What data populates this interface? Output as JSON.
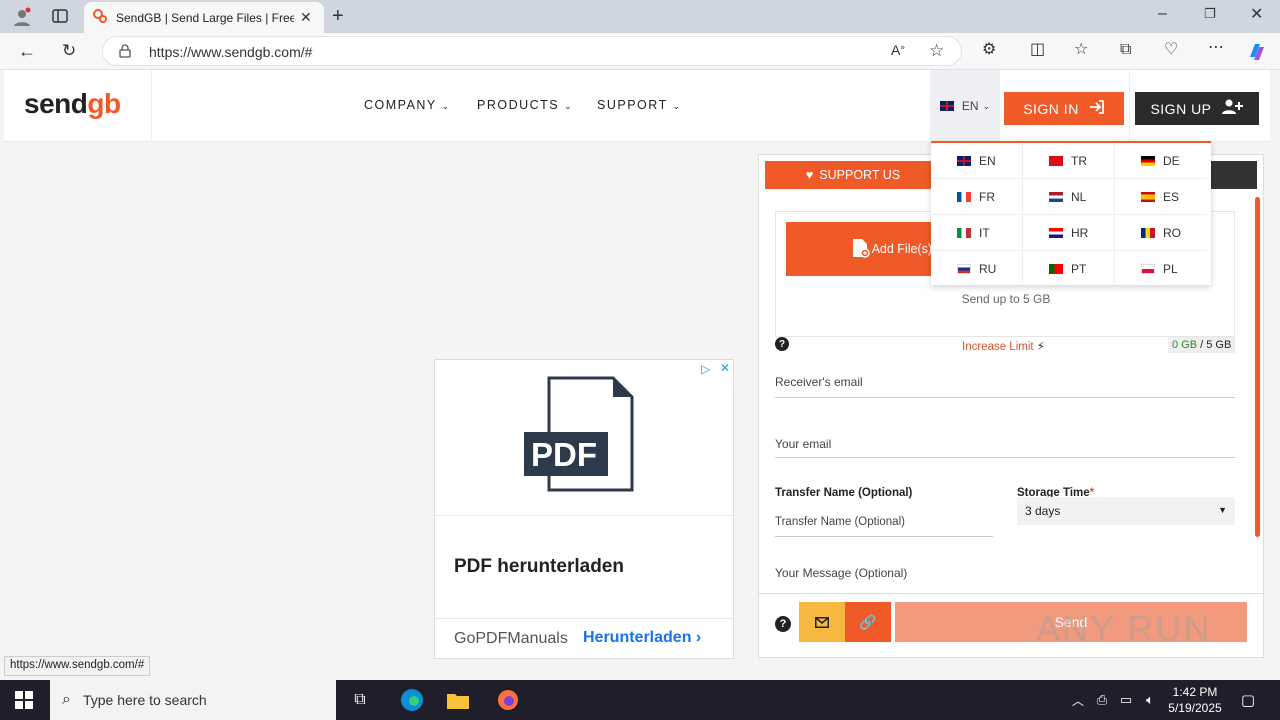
{
  "browser": {
    "tab_title": "SendGB | Send Large Files | Free f",
    "url": "https://www.sendgb.com/#",
    "status_url": "https://www.sendgb.com/#"
  },
  "header": {
    "logo_text_a": "send",
    "logo_text_b": "g",
    "logo_text_c": "b",
    "nav": [
      {
        "label": "COMPANY"
      },
      {
        "label": "PRODUCTS"
      },
      {
        "label": "SUPPORT"
      }
    ],
    "lang_current": "EN",
    "signin_label": "SIGN IN",
    "signup_label": "SIGN UP"
  },
  "languages": [
    {
      "code": "EN",
      "flag": "uk"
    },
    {
      "code": "TR",
      "flag": "tr"
    },
    {
      "code": "DE",
      "flag": "de"
    },
    {
      "code": "FR",
      "flag": "fr"
    },
    {
      "code": "NL",
      "flag": "nl"
    },
    {
      "code": "ES",
      "flag": "es"
    },
    {
      "code": "IT",
      "flag": "it"
    },
    {
      "code": "HR",
      "flag": "hr"
    },
    {
      "code": "RO",
      "flag": "ro"
    },
    {
      "code": "RU",
      "flag": "ru"
    },
    {
      "code": "PT",
      "flag": "pt"
    },
    {
      "code": "PL",
      "flag": "pl"
    }
  ],
  "panel": {
    "support_label": "SUPPORT US",
    "add_files_label": "Add File(s)",
    "send_up_label": "Send up to 5 GB",
    "increase_limit_label": "Increase Limit",
    "usage_used": "0 GB",
    "usage_total": " / 5 GB",
    "receiver_email_placeholder": "Receiver's email",
    "your_email_placeholder": "Your email",
    "transfer_name_label": "Transfer Name (Optional)",
    "transfer_name_placeholder": "Transfer Name (Optional)",
    "storage_time_label": "Storage Time",
    "storage_time_required": "*",
    "storage_time_value": "3 days",
    "message_placeholder": "Your Message  (Optional)",
    "send_label": "Send"
  },
  "ad": {
    "pdf_label": "PDF",
    "title": "PDF herunterladen",
    "brand": "GoPDFManuals",
    "cta": "Herunterladen"
  },
  "taskbar": {
    "search_placeholder": "Type here to search",
    "time": "1:42 PM",
    "date": "5/19/2025"
  },
  "watermark": "ANY RUN",
  "colors": {
    "accent": "#f05a28",
    "dark": "#2b2b2b",
    "mail_button": "#f6b840",
    "send_disabled": "#f29a7d"
  }
}
